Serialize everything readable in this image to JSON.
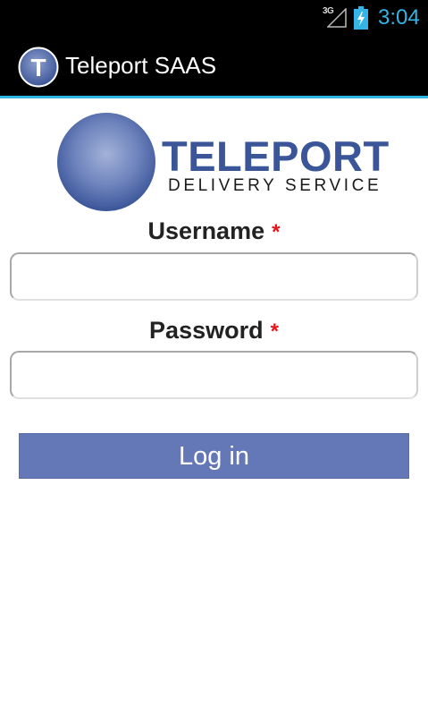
{
  "status_bar": {
    "network": "3G",
    "time": "3:04",
    "signal_icon": "signal-icon",
    "battery_icon": "battery-charging-icon",
    "clock_color": "#33b5e5"
  },
  "action_bar": {
    "title": "Teleport SAAS",
    "icon_letter": "T",
    "divider_color": "#33b5e5"
  },
  "logo": {
    "name": "TELEPORT",
    "tagline": "DELIVERY SERVICE",
    "brand_color": "#3a5598"
  },
  "form": {
    "username_label": "Username",
    "username_required": "*",
    "username_value": "",
    "password_label": "Password",
    "password_required": "*",
    "password_value": "",
    "login_label": "Log in",
    "button_color": "#6478b7",
    "required_color": "#e8141b"
  }
}
